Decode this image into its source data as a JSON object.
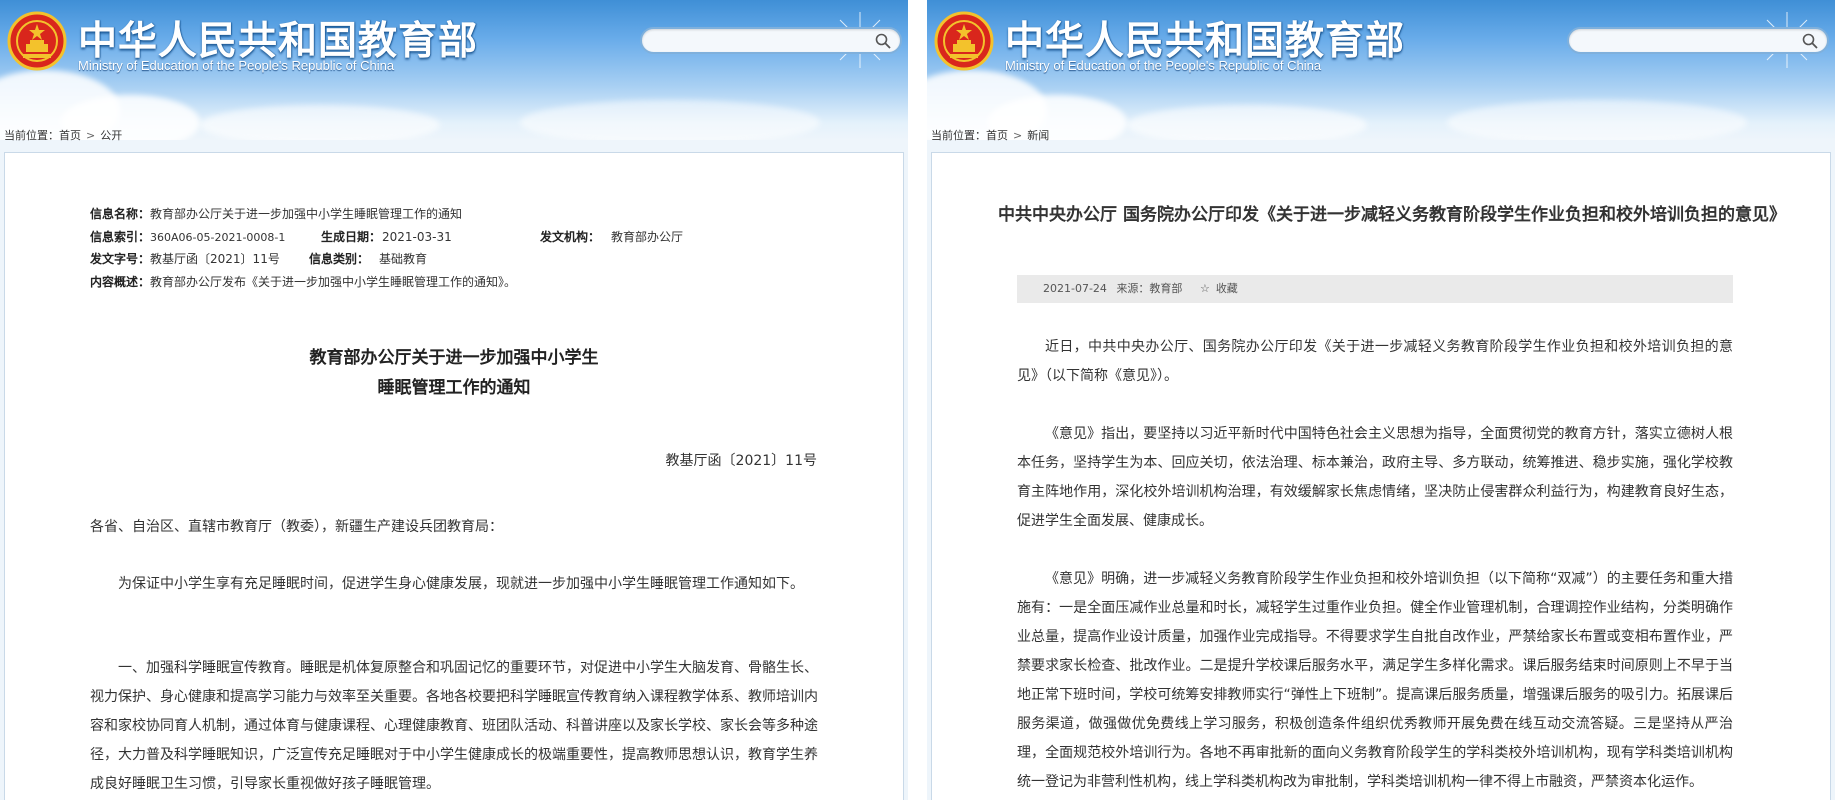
{
  "site": {
    "title": "中华人民共和国教育部",
    "subtitle": "Ministry of Education of the People's Republic of China",
    "search_value": ""
  },
  "left": {
    "breadcrumb": [
      "当前位置：",
      "首页",
      "公开"
    ],
    "meta": {
      "name_label": "信息名称：",
      "name_value": "教育部办公厅关于进一步加强中小学生睡眠管理工作的通知",
      "index_label": "信息索引：",
      "index_value": "360A06-05-2021-0008-1",
      "date_label": "生成日期：",
      "date_value": "2021-03-31",
      "org_label": "发文机构：",
      "org_value": "教育部办公厅",
      "docno_label": "发文字号：",
      "docno_value": "教基厅函〔2021〕11号",
      "cat_label": "信息类别：",
      "cat_value": "基础教育",
      "summary_label": "内容概述：",
      "summary_value": "教育部办公厅发布《关于进一步加强中小学生睡眠管理工作的通知》。"
    },
    "title_line1": "教育部办公厅关于进一步加强中小学生",
    "title_line2": "睡眠管理工作的通知",
    "doc_number": "教基厅函〔2021〕11号",
    "recipients": "各省、自治区、直辖市教育厅（教委），新疆生产建设兵团教育局：",
    "para1": "为保证中小学生享有充足睡眠时间，促进学生身心健康发展，现就进一步加强中小学生睡眠管理工作通知如下。",
    "para2": "一、加强科学睡眠宣传教育。睡眠是机体复原整合和巩固记忆的重要环节，对促进中小学生大脑发育、骨骼生长、视力保护、身心健康和提高学习能力与效率至关重要。各地各校要把科学睡眠宣传教育纳入课程教学体系、教师培训内容和家校协同育人机制，通过体育与健康课程、心理健康教育、班团队活动、科普讲座以及家长学校、家长会等多种途径，大力普及科学睡眠知识，广泛宣传充足睡眠对于中小学生健康成长的极端重要性，提高教师思想认识，教育学生养成良好睡眠卫生习惯，引导家长重视做好孩子睡眠管理。"
  },
  "right": {
    "breadcrumb": [
      "当前位置：",
      "首页",
      "新闻"
    ],
    "title": "中共中央办公厅 国务院办公厅印发《关于进一步减轻义务教育阶段学生作业负担和校外培训负担的意见》",
    "date": "2021-07-24",
    "source": "来源：教育部",
    "favorite": "收藏",
    "para1": "近日，中共中央办公厅、国务院办公厅印发《关于进一步减轻义务教育阶段学生作业负担和校外培训负担的意见》（以下简称《意见》）。",
    "para2": "《意见》指出，要坚持以习近平新时代中国特色社会主义思想为指导，全面贯彻党的教育方针，落实立德树人根本任务，坚持学生为本、回应关切，依法治理、标本兼治，政府主导、多方联动，统筹推进、稳步实施，强化学校教育主阵地作用，深化校外培训机构治理，有效缓解家长焦虑情绪，坚决防止侵害群众利益行为，构建教育良好生态，促进学生全面发展、健康成长。",
    "para3": "《意见》明确，进一步减轻义务教育阶段学生作业负担和校外培训负担（以下简称“双减”）的主要任务和重大措施有：一是全面压减作业总量和时长，减轻学生过重作业负担。健全作业管理机制，合理调控作业结构，分类明确作业总量，提高作业设计质量，加强作业完成指导。不得要求学生自批自改作业，严禁给家长布置或变相布置作业，严禁要求家长检查、批改作业。二是提升学校课后服务水平，满足学生多样化需求。课后服务结束时间原则上不早于当地正常下班时间，学校可统筹安排教师实行“弹性上下班制”。提高课后服务质量，增强课后服务的吸引力。拓展课后服务渠道，做强做优免费线上学习服务，积极创造条件组织优秀教师开展免费在线互动交流答疑。三是坚持从严治理，全面规范校外培训行为。各地不再审批新的面向义务教育阶段学生的学科类校外培训机构，现有学科类培训机构统一登记为非营利性机构，线上学科类机构改为审批制，学科类培训机构一律不得上市融资，严禁资本化运作。"
  }
}
